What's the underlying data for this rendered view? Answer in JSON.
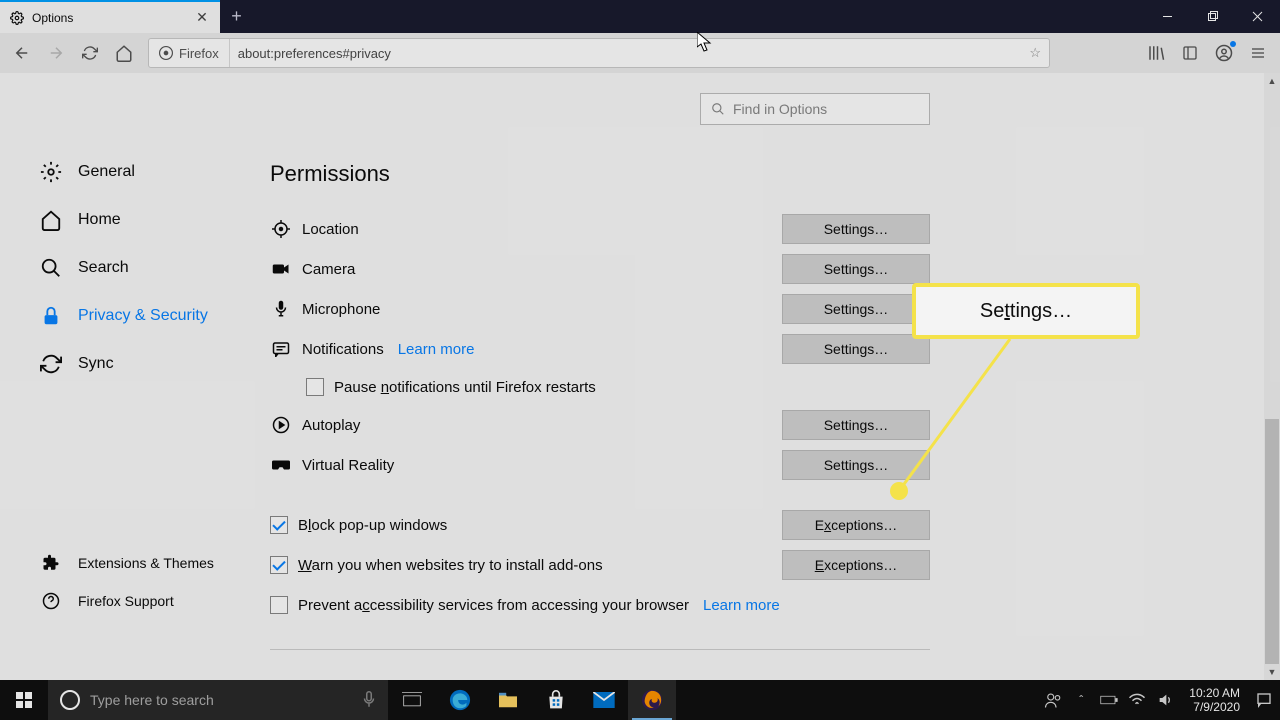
{
  "tab": {
    "title": "Options"
  },
  "address": {
    "identity": "Firefox",
    "url": "about:preferences#privacy"
  },
  "search": {
    "placeholder": "Find in Options"
  },
  "sidebar": {
    "items": [
      {
        "label": "General"
      },
      {
        "label": "Home"
      },
      {
        "label": "Search"
      },
      {
        "label": "Privacy & Security"
      },
      {
        "label": "Sync"
      }
    ],
    "bottom": [
      {
        "label": "Extensions & Themes"
      },
      {
        "label": "Firefox Support"
      }
    ]
  },
  "section": {
    "title": "Permissions"
  },
  "perms": {
    "location": {
      "label": "Location",
      "btn": "Settings…"
    },
    "camera": {
      "label": "Camera",
      "btn": "Settings…"
    },
    "microphone": {
      "label": "Microphone",
      "btn": "Settings…"
    },
    "notifications": {
      "label": "Notifications",
      "link": "Learn more",
      "btn": "Settings…",
      "pause": "Pause notifications until Firefox restarts"
    },
    "autoplay": {
      "label": "Autoplay",
      "btn": "Settings…"
    },
    "vr": {
      "label": "Virtual Reality",
      "btn": "Settings…"
    }
  },
  "checks": {
    "popups": {
      "label_pre": "B",
      "label_und": "l",
      "label_post": "ock pop-up windows",
      "btn_pre": "E",
      "btn_und": "x",
      "btn_post": "ceptions…"
    },
    "addons": {
      "label_pre": "",
      "label_und": "W",
      "label_post": "arn you when websites try to install add-ons",
      "btn_pre": "",
      "btn_und": "E",
      "btn_post": "xceptions…"
    },
    "a11y": {
      "label_pre": "Prevent a",
      "label_und": "c",
      "label_post": "cessibility services from accessing your browser",
      "link": "Learn more"
    }
  },
  "callout": {
    "pre": "Se",
    "und": "t",
    "post": "tings…"
  },
  "taskbar": {
    "search_placeholder": "Type here to search",
    "clock": {
      "time": "10:20 AM",
      "date": "7/9/2020"
    }
  }
}
